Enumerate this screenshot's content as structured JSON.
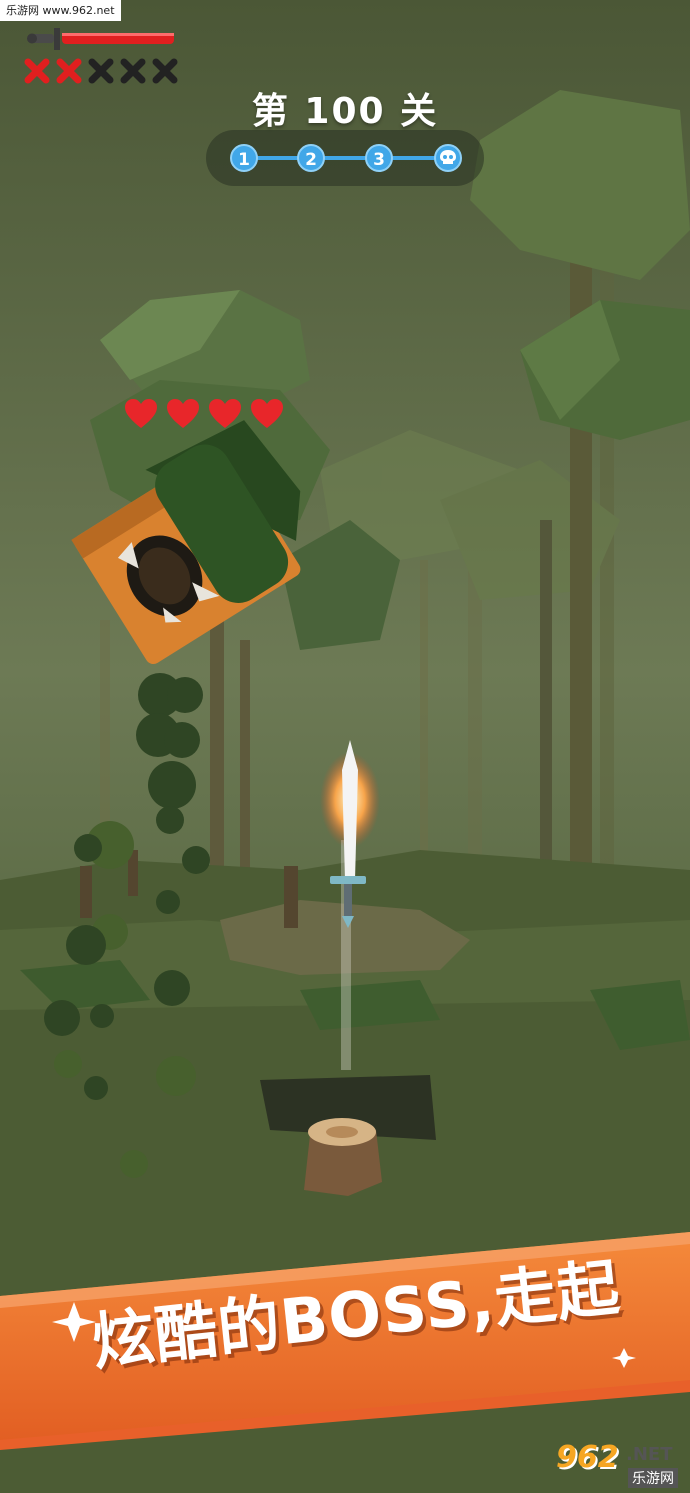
{
  "watermark_top": "乐游网 www.962.net",
  "hud": {
    "lives_total": 5,
    "lives_lost": 2,
    "level_prefix": "第",
    "level_number": "100",
    "level_suffix": "关",
    "stages": [
      "1",
      "2",
      "3",
      "skull-icon"
    ],
    "boss_hearts": 4
  },
  "banner": {
    "text": "炫酷的BOSS,走起"
  },
  "watermark_bottom": {
    "number": "962",
    "suffix": ".NET",
    "sub": "乐游网"
  },
  "colors": {
    "accent_blue": "#41a7e8",
    "heart_red": "#e8262a",
    "banner_orange": "#f07a2e",
    "fog_green": "#5d6b47"
  }
}
